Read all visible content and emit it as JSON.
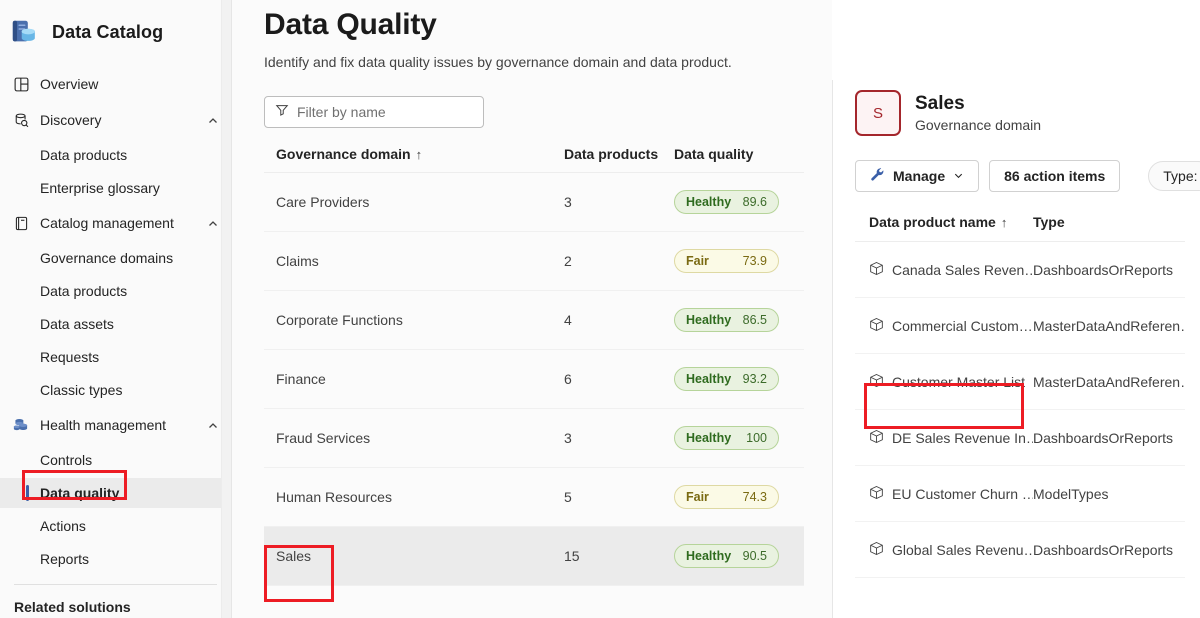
{
  "brand": {
    "title": "Data Catalog",
    "icon": "data-catalog-logo"
  },
  "sidebar": {
    "items": [
      {
        "label": "Overview",
        "icon": "grid-layout-icon",
        "type": "top",
        "expandable": false
      },
      {
        "label": "Discovery",
        "icon": "database-search-icon",
        "type": "top",
        "expandable": true,
        "chevron": "chevron-up"
      },
      {
        "label": "Data products",
        "type": "sub"
      },
      {
        "label": "Enterprise glossary",
        "type": "sub"
      },
      {
        "label": "Catalog management",
        "icon": "book-icon",
        "type": "top",
        "expandable": true,
        "chevron": "chevron-up"
      },
      {
        "label": "Governance domains",
        "type": "sub"
      },
      {
        "label": "Data products",
        "type": "sub"
      },
      {
        "label": "Data assets",
        "type": "sub"
      },
      {
        "label": "Requests",
        "type": "sub"
      },
      {
        "label": "Classic types",
        "type": "sub"
      },
      {
        "label": "Health management",
        "icon": "stacked-databases-icon",
        "type": "top",
        "expandable": true,
        "chevron": "chevron-up"
      },
      {
        "label": "Controls",
        "type": "sub"
      },
      {
        "label": "Data quality",
        "type": "sub",
        "selected": true
      },
      {
        "label": "Actions",
        "type": "sub"
      },
      {
        "label": "Reports",
        "type": "sub"
      }
    ],
    "footer_label": "Related solutions"
  },
  "main": {
    "title": "Data Quality",
    "subtitle": "Identify and fix data quality issues by governance domain and data product.",
    "filter": {
      "placeholder": "Filter by name",
      "value": "",
      "icon": "funnel-filter-icon"
    },
    "table": {
      "columns": {
        "domain": "Governance domain",
        "sort_indicator": "↑",
        "products": "Data products",
        "quality": "Data quality"
      },
      "rows": [
        {
          "domain": "Care Providers",
          "products": "3",
          "status": "Healthy",
          "score": "89.6",
          "tone": "healthy",
          "selected": false
        },
        {
          "domain": "Claims",
          "products": "2",
          "status": "Fair",
          "score": "73.9",
          "tone": "fair",
          "selected": false
        },
        {
          "domain": "Corporate Functions",
          "products": "4",
          "status": "Healthy",
          "score": "86.5",
          "tone": "healthy",
          "selected": false
        },
        {
          "domain": "Finance",
          "products": "6",
          "status": "Healthy",
          "score": "93.2",
          "tone": "healthy",
          "selected": false
        },
        {
          "domain": "Fraud Services",
          "products": "3",
          "status": "Healthy",
          "score": "100",
          "tone": "healthy",
          "selected": false
        },
        {
          "domain": "Human Resources",
          "products": "5",
          "status": "Fair",
          "score": "74.3",
          "tone": "fair",
          "selected": false
        },
        {
          "domain": "Sales",
          "products": "15",
          "status": "Healthy",
          "score": "90.5",
          "tone": "healthy",
          "selected": true
        }
      ]
    }
  },
  "detail": {
    "avatar_initial": "S",
    "name": "Sales",
    "kind": "Governance domain",
    "toolbar": {
      "manage_label": "Manage",
      "manage_icon": "wrench-icon",
      "manage_chevron": "chevron-down-icon",
      "action_items_label": "86 action items",
      "type_filter_label": "Type:"
    },
    "table": {
      "columns": {
        "name": "Data product name",
        "sort_indicator": "↑",
        "type": "Type"
      },
      "rows": [
        {
          "name": "Canada Sales Reven…",
          "type": "DashboardsOrReports",
          "highlighted": false
        },
        {
          "name": "Commercial Custom…",
          "type": "MasterDataAndReferen…",
          "highlighted": false
        },
        {
          "name": "Customer Master List",
          "type": "MasterDataAndReferen…",
          "highlighted": true
        },
        {
          "name": "DE Sales Revenue In…",
          "type": "DashboardsOrReports",
          "highlighted": false
        },
        {
          "name": "EU Customer Churn …",
          "type": "ModelTypes",
          "highlighted": false
        },
        {
          "name": "Global Sales Revenu…",
          "type": "DashboardsOrReports",
          "highlighted": false
        }
      ]
    }
  },
  "annotations": {
    "color": "#ed1c24",
    "targets": [
      "sidebar-item-data-quality",
      "table-row-sales",
      "data-product-customer-master-list"
    ]
  }
}
